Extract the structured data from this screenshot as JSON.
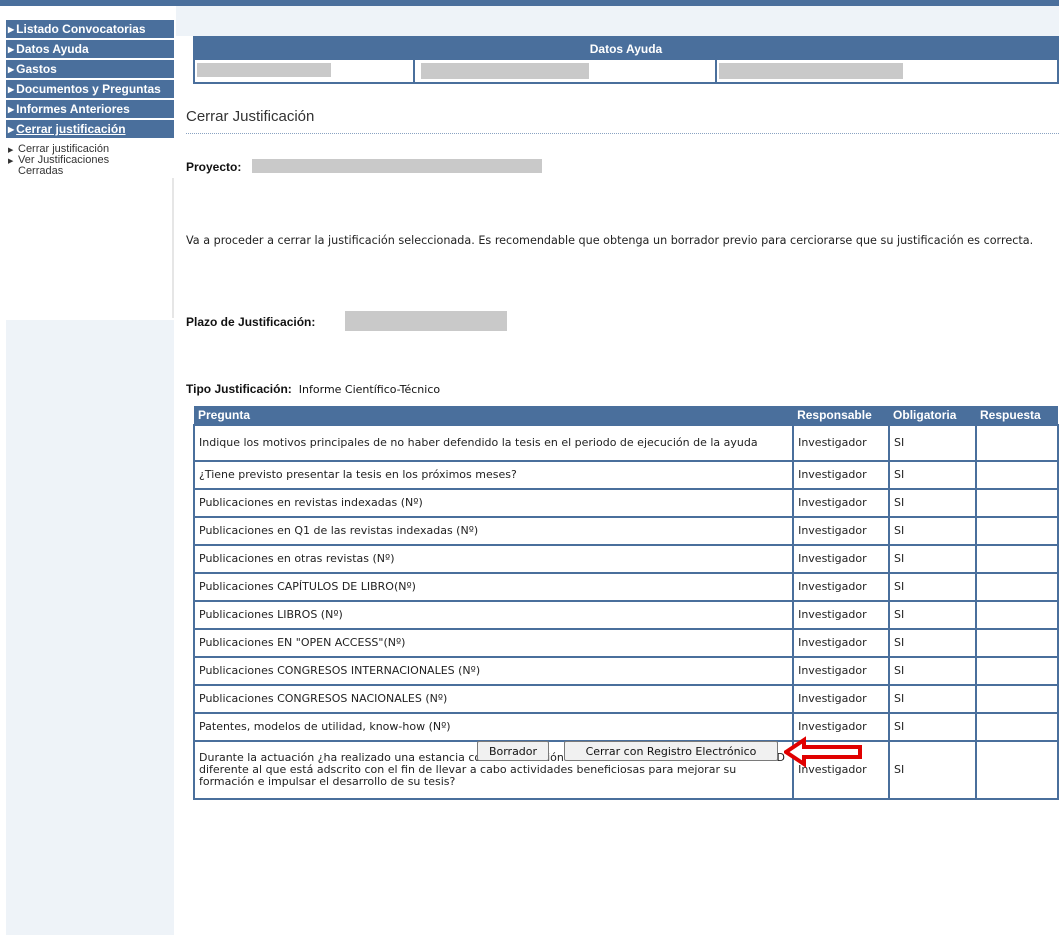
{
  "sidebar": {
    "items": [
      {
        "label": "Listado Convocatorias"
      },
      {
        "label": "Datos Ayuda"
      },
      {
        "label": "Gastos"
      },
      {
        "label": "Documentos y Preguntas"
      },
      {
        "label": "Informes Anteriores"
      },
      {
        "label": "Cerrar justificación"
      }
    ],
    "subitems": [
      {
        "label": "Cerrar justificación"
      },
      {
        "label": "Ver Justificaciones Cerradas"
      }
    ]
  },
  "datos_ayuda": {
    "title": "Datos Ayuda"
  },
  "page": {
    "title": "Cerrar Justificación",
    "proyecto_label": "Proyecto:",
    "info_text": "Va a proceder a cerrar la justificación seleccionada. Es recomendable que obtenga un borrador previo para cerciorarse que su justificación es correcta.",
    "plazo_label": "Plazo de Justificación:",
    "tipo_label": "Tipo Justificación:",
    "tipo_value": "Informe Científico-Técnico"
  },
  "table": {
    "headers": {
      "pregunta": "Pregunta",
      "responsable": "Responsable",
      "obligatoria": "Obligatoria",
      "respuesta": "Respuesta"
    },
    "rows": [
      {
        "pregunta": "Indique los motivos principales de no haber defendido la tesis en el periodo de ejecución de la ayuda",
        "responsable": "Investigador",
        "obligatoria": "SI",
        "respuesta": ""
      },
      {
        "pregunta": "¿Tiene previsto presentar la tesis en los próximos meses?",
        "responsable": "Investigador",
        "obligatoria": "SI",
        "respuesta": ""
      },
      {
        "pregunta": "Publicaciones en revistas indexadas (Nº)",
        "responsable": "Investigador",
        "obligatoria": "SI",
        "respuesta": ""
      },
      {
        "pregunta": "Publicaciones en Q1 de las revistas indexadas (Nº)",
        "responsable": "Investigador",
        "obligatoria": "SI",
        "respuesta": ""
      },
      {
        "pregunta": "Publicaciones en otras revistas (Nº)",
        "responsable": "Investigador",
        "obligatoria": "SI",
        "respuesta": ""
      },
      {
        "pregunta": "Publicaciones CAPÍTULOS DE LIBRO(Nº)",
        "responsable": "Investigador",
        "obligatoria": "SI",
        "respuesta": ""
      },
      {
        "pregunta": "Publicaciones LIBROS (Nº)",
        "responsable": "Investigador",
        "obligatoria": "SI",
        "respuesta": ""
      },
      {
        "pregunta": "Publicaciones EN \"OPEN ACCESS\"(Nº)",
        "responsable": "Investigador",
        "obligatoria": "SI",
        "respuesta": ""
      },
      {
        "pregunta": "Publicaciones CONGRESOS INTERNACIONALES (Nº)",
        "responsable": "Investigador",
        "obligatoria": "SI",
        "respuesta": ""
      },
      {
        "pregunta": "Publicaciones CONGRESOS NACIONALES (Nº)",
        "responsable": "Investigador",
        "obligatoria": "SI",
        "respuesta": ""
      },
      {
        "pregunta": "Patentes, modelos de utilidad, know-how (Nº)",
        "responsable": "Investigador",
        "obligatoria": "SI",
        "respuesta": ""
      },
      {
        "pregunta": "Durante la actuación ¿ha realizado una estancia con una duración mínima de un mes en un centro de I+D diferente al que está adscrito con el fin de llevar a cabo actividades beneficiosas para mejorar su formación e impulsar el desarrollo de su tesis?",
        "responsable": "Investigador",
        "obligatoria": "SI",
        "respuesta": ""
      }
    ]
  },
  "buttons": {
    "borrador": "Borrador",
    "cerrar_registro": "Cerrar con Registro Electrónico"
  },
  "colors": {
    "accent": "#4a6f9c",
    "arrow": "#e00000",
    "redaction": "#c9c9c9"
  }
}
